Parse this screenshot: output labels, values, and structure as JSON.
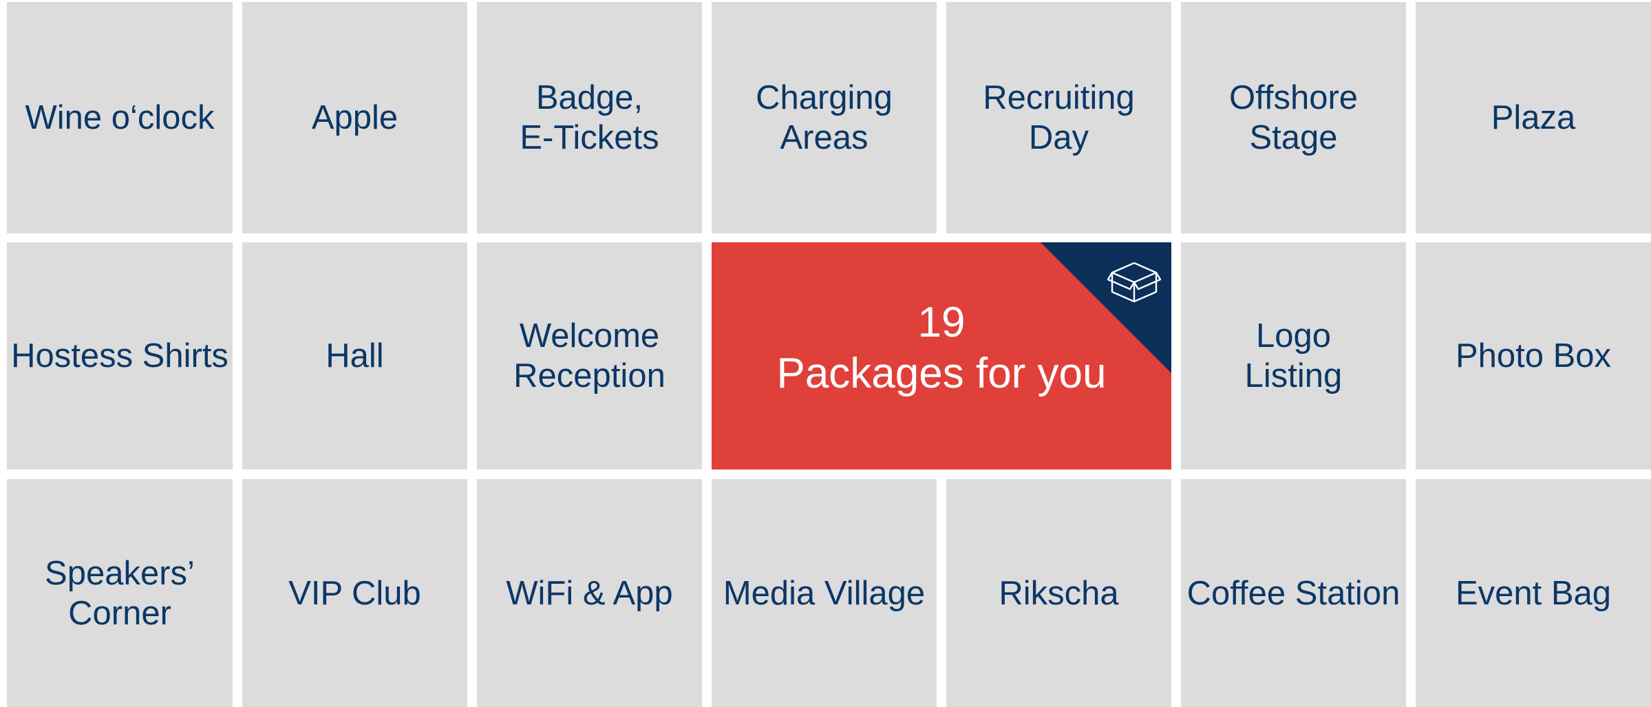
{
  "tiles": {
    "r1": [
      "Wine o‘clock",
      "Apple",
      "Badge,\nE-Tickets",
      "Charging\nAreas",
      "Recruiting\nDay",
      "Offshore\nStage",
      "Plaza"
    ],
    "r2": [
      "Hostess Shirts",
      "Hall",
      "Welcome\nReception",
      "Logo\nListing",
      "Photo Box"
    ],
    "r3": [
      "Speakers’\nCorner",
      "VIP Club",
      "WiFi & App",
      "Media Village",
      "Rikscha",
      "Coffee Station",
      "Event Bag"
    ]
  },
  "featured": {
    "count": "19",
    "caption": "Packages for you",
    "icon": "package-box-icon"
  },
  "colors": {
    "tile_bg": "#dcdcdc",
    "tile_text": "#0b3766",
    "featured_bg": "#e0403a",
    "featured_corner": "#0b2f59",
    "featured_text": "#ffffff"
  }
}
